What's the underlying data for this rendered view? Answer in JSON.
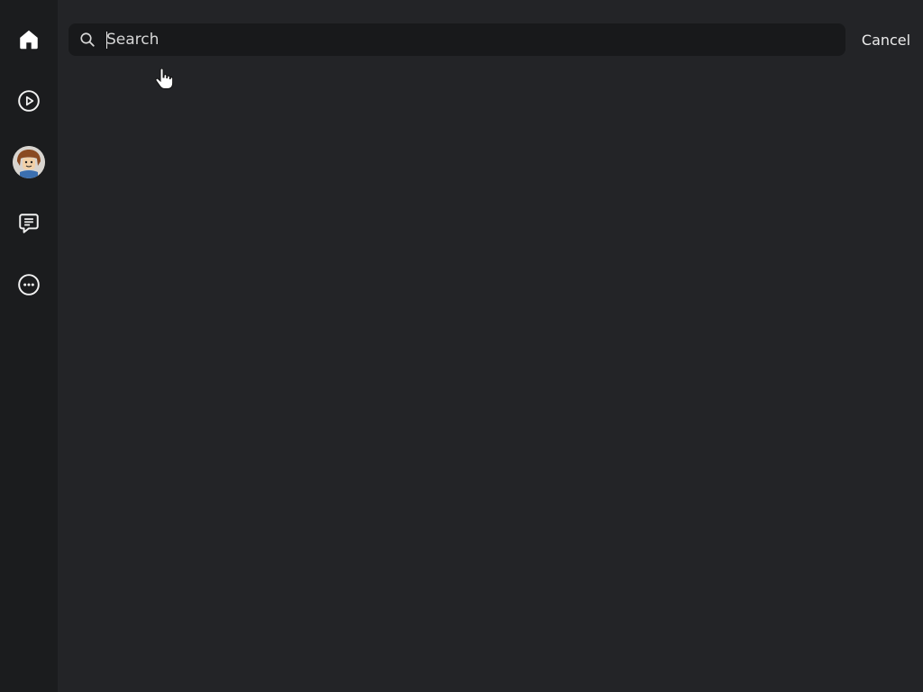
{
  "sidebar": {
    "items": [
      {
        "name": "home",
        "icon": "home-icon",
        "active": true
      },
      {
        "name": "play",
        "icon": "play-circle-icon",
        "active": false
      },
      {
        "name": "avatar",
        "icon": "avatar-icon",
        "active": false
      },
      {
        "name": "chat",
        "icon": "chat-icon",
        "active": false
      },
      {
        "name": "more",
        "icon": "more-icon",
        "active": false
      }
    ]
  },
  "search": {
    "placeholder": "Search",
    "value": "",
    "icon": "search-icon"
  },
  "header": {
    "cancel_label": "Cancel"
  },
  "colors": {
    "background": "#232427",
    "sidebar": "#1b1c1e",
    "search_field": "#18191b",
    "text": "#ececec"
  }
}
